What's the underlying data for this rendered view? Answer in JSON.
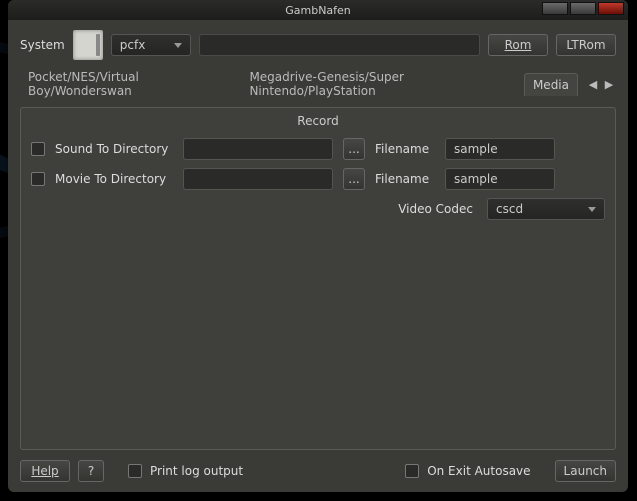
{
  "window": {
    "title": "GambNafen"
  },
  "toolbar": {
    "system_label": "System",
    "system_select_value": "pcfx",
    "rom_path": "",
    "rom_button": "Rom",
    "ltrom_button": "LTRom"
  },
  "tabs": {
    "tab1": "Pocket/NES/Virtual Boy/Wonderswan",
    "tab2": "Megadrive-Genesis/Super Nintendo/PlayStation",
    "tab3": "Media"
  },
  "record": {
    "title": "Record",
    "sound_label": "Sound To Directory",
    "sound_path": "",
    "sound_filename_label": "Filename",
    "sound_filename": "sample",
    "movie_label": "Movie To Directory",
    "movie_path": "",
    "movie_filename_label": "Filename",
    "movie_filename": "sample",
    "browse": "...",
    "video_codec_label": "Video Codec",
    "video_codec_value": "cscd"
  },
  "footer": {
    "help": "Help",
    "question": "?",
    "print_log": "Print log output",
    "on_exit_autosave": "On Exit Autosave",
    "launch": "Launch"
  }
}
